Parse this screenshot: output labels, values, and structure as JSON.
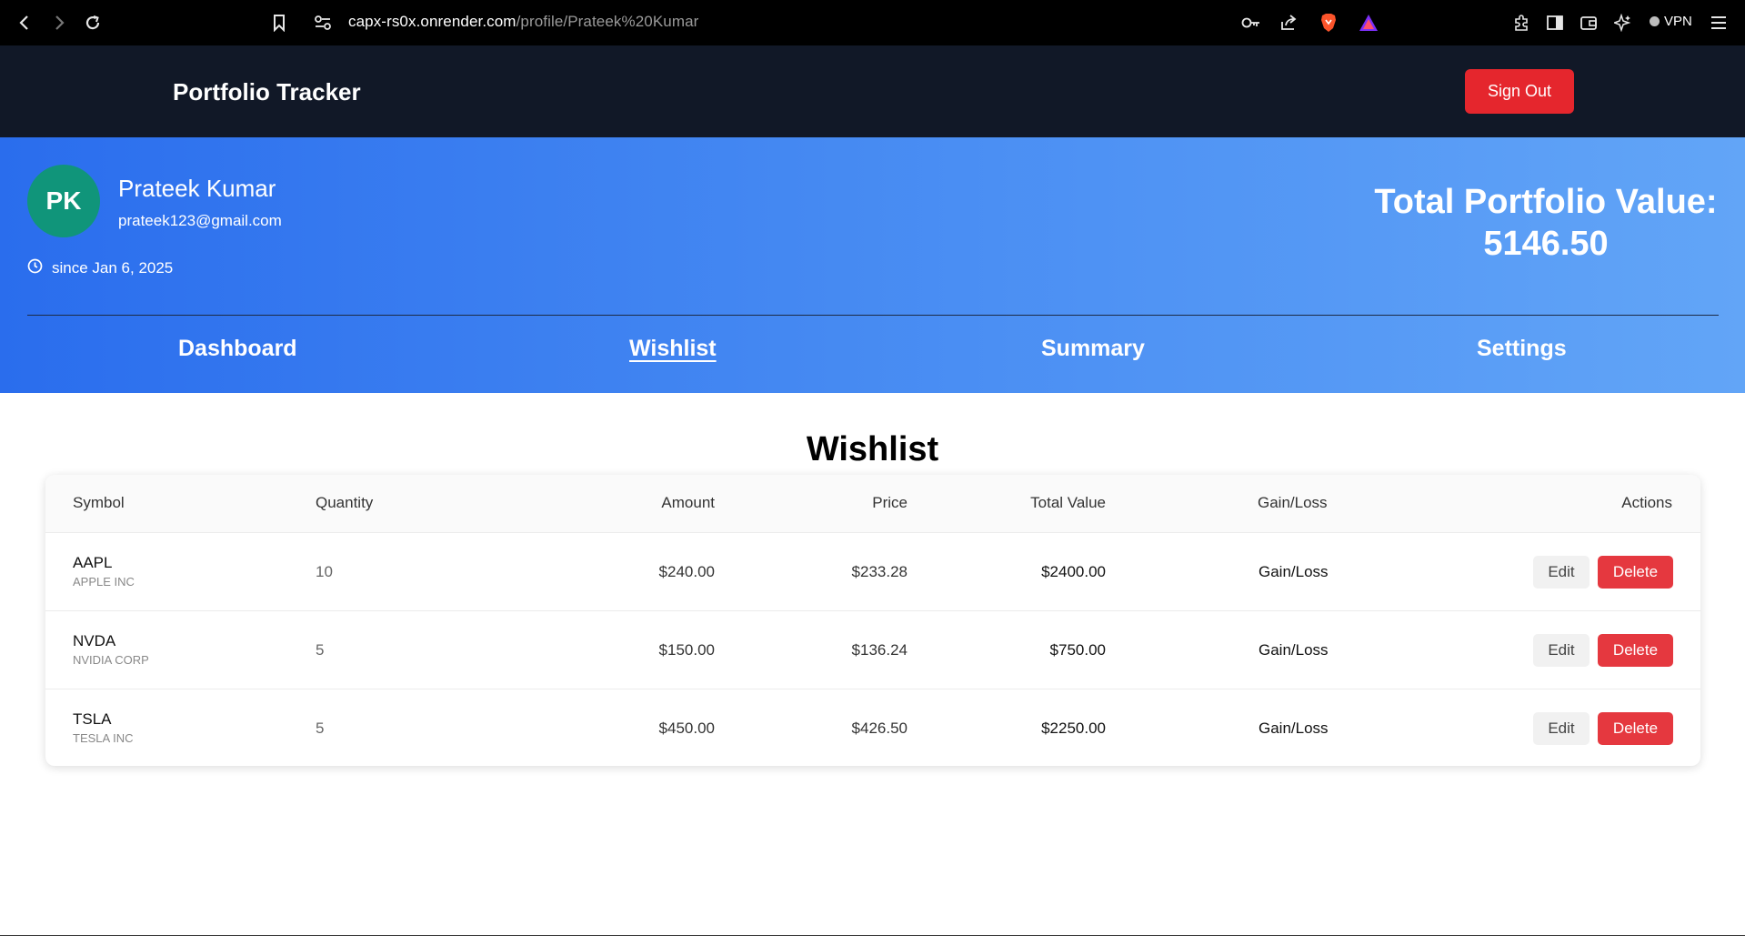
{
  "browser": {
    "url_host": "capx-rs0x.onrender.com",
    "url_path": "/profile/Prateek%20Kumar",
    "vpn_label": "VPN"
  },
  "header": {
    "title": "Portfolio Tracker",
    "signout_label": "Sign Out"
  },
  "profile": {
    "initials": "PK",
    "name": "Prateek Kumar",
    "email": "prateek123@gmail.com",
    "since": "since Jan 6, 2025",
    "total_label": "Total Portfolio Value:",
    "total_value": "5146.50"
  },
  "tabs": [
    {
      "label": "Dashboard"
    },
    {
      "label": "Wishlist"
    },
    {
      "label": "Summary"
    },
    {
      "label": "Settings"
    }
  ],
  "wishlist": {
    "title": "Wishlist",
    "columns": [
      "Symbol",
      "Quantity",
      "Amount",
      "Price",
      "Total Value",
      "Gain/Loss",
      "Actions"
    ],
    "rows": [
      {
        "symbol": "AAPL",
        "company": "APPLE INC",
        "quantity": "10",
        "amount": "$240.00",
        "price": "$233.28",
        "total": "$2400.00",
        "gain": "Gain/Loss",
        "edit": "Edit",
        "delete": "Delete"
      },
      {
        "symbol": "NVDA",
        "company": "NVIDIA CORP",
        "quantity": "5",
        "amount": "$150.00",
        "price": "$136.24",
        "total": "$750.00",
        "gain": "Gain/Loss",
        "edit": "Edit",
        "delete": "Delete"
      },
      {
        "symbol": "TSLA",
        "company": "TESLA INC",
        "quantity": "5",
        "amount": "$450.00",
        "price": "$426.50",
        "total": "$2250.00",
        "gain": "Gain/Loss",
        "edit": "Edit",
        "delete": "Delete"
      }
    ]
  },
  "colors": {
    "accent_red": "#e5262d",
    "avatar_green": "#10957a",
    "hero_gradient_start": "#2a6ded",
    "hero_gradient_end": "#62a5f7",
    "header_bg": "#111827"
  }
}
